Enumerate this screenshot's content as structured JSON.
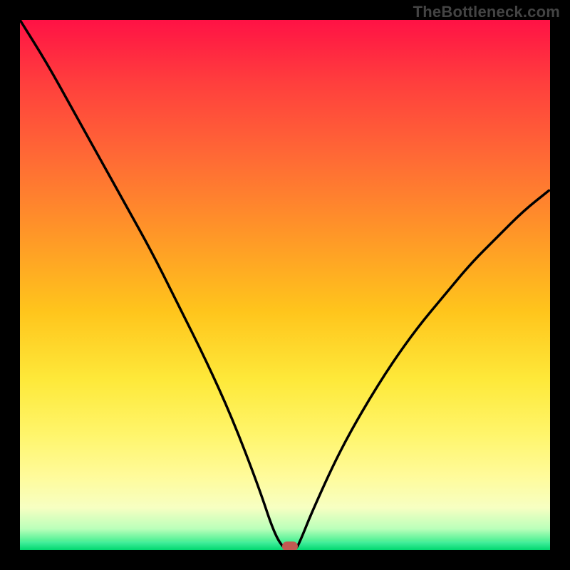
{
  "watermark": "TheBottleneck.com",
  "colors": {
    "curve_stroke": "#000000",
    "marker_fill": "#c15a52"
  },
  "chart_data": {
    "type": "line",
    "title": "",
    "xlabel": "",
    "ylabel": "",
    "xlim": [
      0,
      100
    ],
    "ylim": [
      0,
      100
    ],
    "grid": false,
    "series": [
      {
        "name": "bottleneck-curve",
        "x": [
          0,
          5,
          10,
          15,
          20,
          25,
          30,
          35,
          40,
          45,
          48,
          50,
          51,
          52,
          53,
          55,
          60,
          65,
          70,
          75,
          80,
          85,
          90,
          95,
          100
        ],
        "values": [
          100,
          92,
          83,
          74,
          65,
          56,
          46,
          36,
          25,
          12,
          3,
          0,
          0,
          0,
          2,
          7,
          18,
          27,
          35,
          42,
          48,
          54,
          59,
          64,
          68
        ]
      }
    ],
    "annotation": {
      "name": "bottleneck-point",
      "x": 51,
      "y": 0
    }
  }
}
